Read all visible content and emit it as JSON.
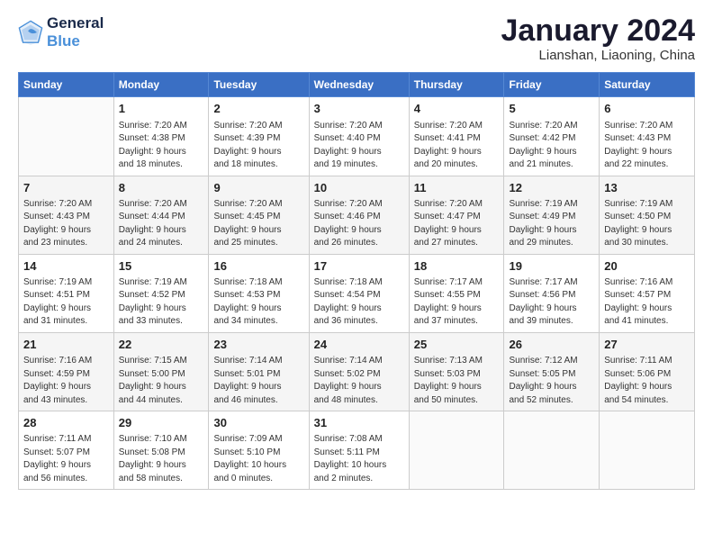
{
  "header": {
    "logo_line1": "General",
    "logo_line2": "Blue",
    "month_title": "January 2024",
    "subtitle": "Lianshan, Liaoning, China"
  },
  "days_of_week": [
    "Sunday",
    "Monday",
    "Tuesday",
    "Wednesday",
    "Thursday",
    "Friday",
    "Saturday"
  ],
  "weeks": [
    [
      {
        "day": "",
        "info": ""
      },
      {
        "day": "1",
        "info": "Sunrise: 7:20 AM\nSunset: 4:38 PM\nDaylight: 9 hours\nand 18 minutes."
      },
      {
        "day": "2",
        "info": "Sunrise: 7:20 AM\nSunset: 4:39 PM\nDaylight: 9 hours\nand 18 minutes."
      },
      {
        "day": "3",
        "info": "Sunrise: 7:20 AM\nSunset: 4:40 PM\nDaylight: 9 hours\nand 19 minutes."
      },
      {
        "day": "4",
        "info": "Sunrise: 7:20 AM\nSunset: 4:41 PM\nDaylight: 9 hours\nand 20 minutes."
      },
      {
        "day": "5",
        "info": "Sunrise: 7:20 AM\nSunset: 4:42 PM\nDaylight: 9 hours\nand 21 minutes."
      },
      {
        "day": "6",
        "info": "Sunrise: 7:20 AM\nSunset: 4:43 PM\nDaylight: 9 hours\nand 22 minutes."
      }
    ],
    [
      {
        "day": "7",
        "info": "Sunrise: 7:20 AM\nSunset: 4:43 PM\nDaylight: 9 hours\nand 23 minutes."
      },
      {
        "day": "8",
        "info": "Sunrise: 7:20 AM\nSunset: 4:44 PM\nDaylight: 9 hours\nand 24 minutes."
      },
      {
        "day": "9",
        "info": "Sunrise: 7:20 AM\nSunset: 4:45 PM\nDaylight: 9 hours\nand 25 minutes."
      },
      {
        "day": "10",
        "info": "Sunrise: 7:20 AM\nSunset: 4:46 PM\nDaylight: 9 hours\nand 26 minutes."
      },
      {
        "day": "11",
        "info": "Sunrise: 7:20 AM\nSunset: 4:47 PM\nDaylight: 9 hours\nand 27 minutes."
      },
      {
        "day": "12",
        "info": "Sunrise: 7:19 AM\nSunset: 4:49 PM\nDaylight: 9 hours\nand 29 minutes."
      },
      {
        "day": "13",
        "info": "Sunrise: 7:19 AM\nSunset: 4:50 PM\nDaylight: 9 hours\nand 30 minutes."
      }
    ],
    [
      {
        "day": "14",
        "info": "Sunrise: 7:19 AM\nSunset: 4:51 PM\nDaylight: 9 hours\nand 31 minutes."
      },
      {
        "day": "15",
        "info": "Sunrise: 7:19 AM\nSunset: 4:52 PM\nDaylight: 9 hours\nand 33 minutes."
      },
      {
        "day": "16",
        "info": "Sunrise: 7:18 AM\nSunset: 4:53 PM\nDaylight: 9 hours\nand 34 minutes."
      },
      {
        "day": "17",
        "info": "Sunrise: 7:18 AM\nSunset: 4:54 PM\nDaylight: 9 hours\nand 36 minutes."
      },
      {
        "day": "18",
        "info": "Sunrise: 7:17 AM\nSunset: 4:55 PM\nDaylight: 9 hours\nand 37 minutes."
      },
      {
        "day": "19",
        "info": "Sunrise: 7:17 AM\nSunset: 4:56 PM\nDaylight: 9 hours\nand 39 minutes."
      },
      {
        "day": "20",
        "info": "Sunrise: 7:16 AM\nSunset: 4:57 PM\nDaylight: 9 hours\nand 41 minutes."
      }
    ],
    [
      {
        "day": "21",
        "info": "Sunrise: 7:16 AM\nSunset: 4:59 PM\nDaylight: 9 hours\nand 43 minutes."
      },
      {
        "day": "22",
        "info": "Sunrise: 7:15 AM\nSunset: 5:00 PM\nDaylight: 9 hours\nand 44 minutes."
      },
      {
        "day": "23",
        "info": "Sunrise: 7:14 AM\nSunset: 5:01 PM\nDaylight: 9 hours\nand 46 minutes."
      },
      {
        "day": "24",
        "info": "Sunrise: 7:14 AM\nSunset: 5:02 PM\nDaylight: 9 hours\nand 48 minutes."
      },
      {
        "day": "25",
        "info": "Sunrise: 7:13 AM\nSunset: 5:03 PM\nDaylight: 9 hours\nand 50 minutes."
      },
      {
        "day": "26",
        "info": "Sunrise: 7:12 AM\nSunset: 5:05 PM\nDaylight: 9 hours\nand 52 minutes."
      },
      {
        "day": "27",
        "info": "Sunrise: 7:11 AM\nSunset: 5:06 PM\nDaylight: 9 hours\nand 54 minutes."
      }
    ],
    [
      {
        "day": "28",
        "info": "Sunrise: 7:11 AM\nSunset: 5:07 PM\nDaylight: 9 hours\nand 56 minutes."
      },
      {
        "day": "29",
        "info": "Sunrise: 7:10 AM\nSunset: 5:08 PM\nDaylight: 9 hours\nand 58 minutes."
      },
      {
        "day": "30",
        "info": "Sunrise: 7:09 AM\nSunset: 5:10 PM\nDaylight: 10 hours\nand 0 minutes."
      },
      {
        "day": "31",
        "info": "Sunrise: 7:08 AM\nSunset: 5:11 PM\nDaylight: 10 hours\nand 2 minutes."
      },
      {
        "day": "",
        "info": ""
      },
      {
        "day": "",
        "info": ""
      },
      {
        "day": "",
        "info": ""
      }
    ]
  ]
}
